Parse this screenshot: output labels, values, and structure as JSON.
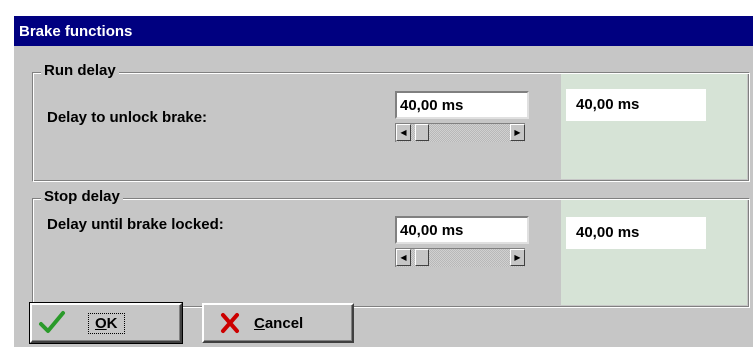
{
  "dialog": {
    "title": "Brake functions"
  },
  "run_delay": {
    "group_title": "Run delay",
    "label": "Delay to unlock brake:",
    "input_value": "40,00 ms",
    "readout_value": "40,00 ms",
    "slider_fraction": 0.05
  },
  "stop_delay": {
    "group_title": "Stop delay",
    "label": "Delay until brake locked:",
    "input_value": "40,00 ms",
    "readout_value": "40,00 ms",
    "slider_fraction": 0.05
  },
  "buttons": {
    "ok_accel": "O",
    "ok_rest": "K",
    "cancel_accel": "C",
    "cancel_rest": "ancel"
  },
  "icons": {
    "ok": "checkmark-icon",
    "cancel": "x-mark-icon"
  },
  "colors": {
    "titlebar": "#000080",
    "dialog_bg": "#c6c6c6",
    "readout_panel": "#d6e3d6",
    "ok_check": "#2a9a2a",
    "cancel_x": "#cc0000"
  }
}
